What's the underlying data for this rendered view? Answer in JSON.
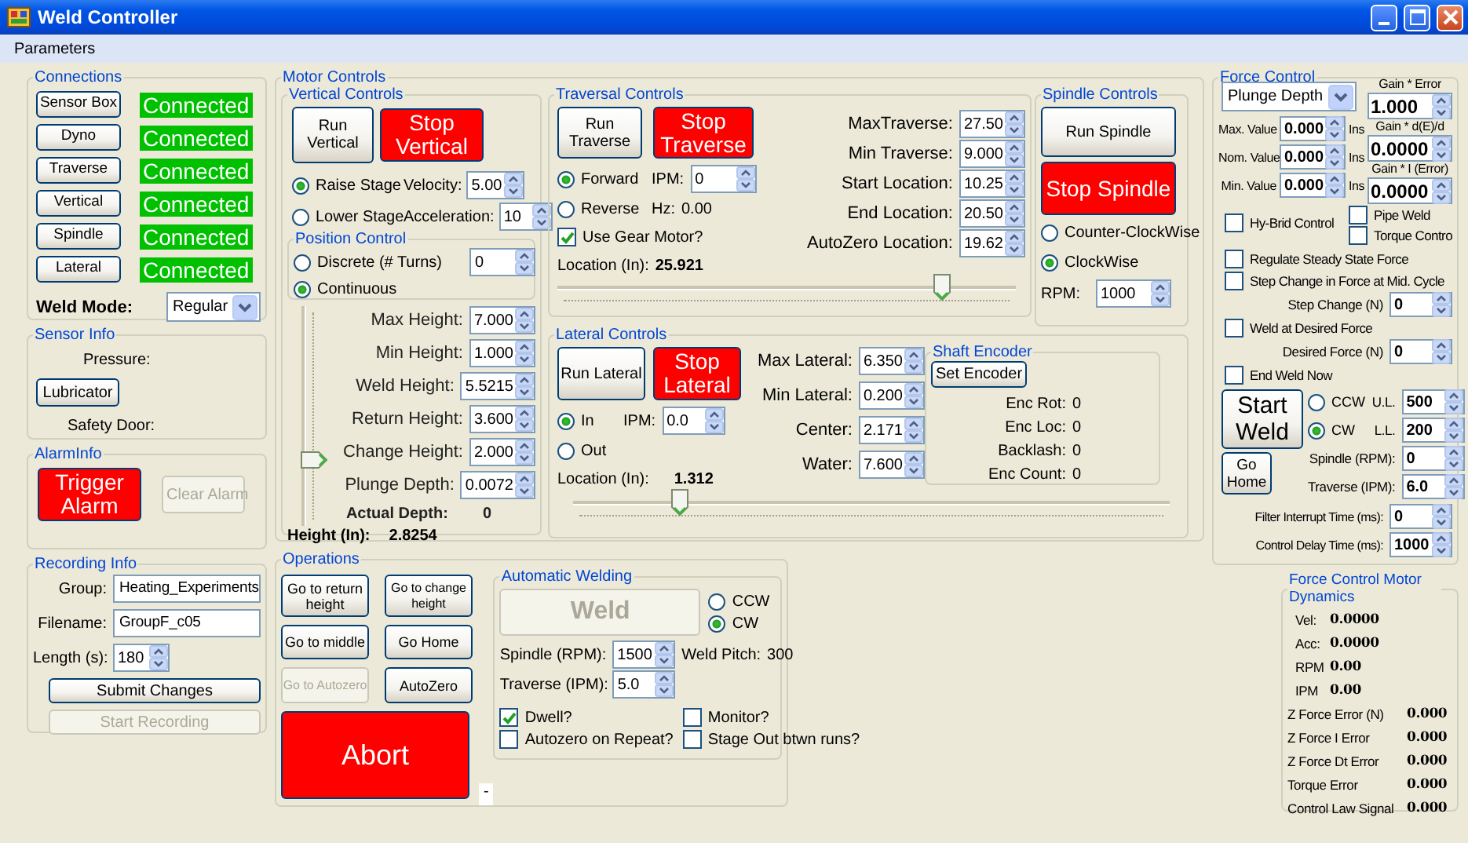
{
  "window": {
    "title": "Weld Controller"
  },
  "menu": [
    {
      "label": "Parameters"
    }
  ],
  "connections": {
    "title": "Connections",
    "rows": [
      [
        {
          "kind": "button",
          "label": "Sensor Box",
          "disabled": false
        },
        {
          "kind": "status",
          "text": "Connected"
        }
      ],
      [
        {
          "kind": "button",
          "label": "Dyno",
          "disabled": false
        },
        {
          "kind": "status",
          "text": "Connected"
        }
      ],
      [
        {
          "kind": "button",
          "label": "Traverse",
          "disabled": false
        },
        {
          "kind": "status",
          "text": "Connected"
        }
      ],
      [
        {
          "kind": "button",
          "label": "Vertical",
          "disabled": false
        },
        {
          "kind": "status",
          "text": "Connected"
        }
      ],
      [
        {
          "kind": "button",
          "label": "Spindle",
          "disabled": false
        },
        {
          "kind": "status",
          "text": "Connected"
        }
      ],
      [
        {
          "kind": "button",
          "label": "Lateral",
          "disabled": false
        },
        {
          "kind": "status",
          "text": "Connected"
        }
      ],
      [
        {
          "kind": "label_bold",
          "text": "Weld Mode:"
        },
        {
          "kind": "combo",
          "value": "Regular"
        }
      ]
    ]
  },
  "sensor_info": {
    "title": "Sensor Info",
    "rows": [
      [
        {
          "kind": "label",
          "text": "Pressure:"
        }
      ],
      [
        {
          "kind": "button",
          "label": "Lubricator",
          "disabled": false
        }
      ],
      [
        {
          "kind": "label",
          "text": "Safety Door:"
        }
      ]
    ]
  },
  "alarm_info": {
    "title": "AlarmInfo",
    "rows": [
      [
        {
          "kind": "stop_button",
          "label": "Trigger Alarm"
        },
        {
          "kind": "button",
          "label": "Clear Alarm",
          "disabled": true
        }
      ]
    ]
  },
  "recording_info": {
    "title": "Recording Info",
    "rows": [
      [
        {
          "kind": "label",
          "text": "Group:"
        },
        {
          "kind": "field",
          "value": "Heating_Experiments"
        }
      ],
      [
        {
          "kind": "label",
          "text": "Filename:"
        },
        {
          "kind": "field",
          "value": "GroupF_c05"
        }
      ],
      [
        {
          "kind": "label",
          "text": "Length (s):"
        },
        {
          "kind": "spin",
          "value": "180"
        }
      ],
      [
        {
          "kind": "button",
          "label": "Submit Changes",
          "disabled": false
        }
      ],
      [
        {
          "kind": "button",
          "label": "Start Recording",
          "disabled": true
        }
      ]
    ]
  },
  "motor_controls": {
    "title": "Motor Controls",
    "vertical": {
      "title": "Vertical Controls",
      "rows": [
        [
          {
            "kind": "button",
            "label": "Run Vertical",
            "disabled": false
          },
          {
            "kind": "stop_button",
            "label": "Stop Vertical"
          }
        ],
        [
          {
            "kind": "radio",
            "label": "Raise Stage",
            "selected": true
          },
          {
            "kind": "label",
            "text": "Velocity:"
          },
          {
            "kind": "spin",
            "value": "5.00"
          }
        ],
        [
          {
            "kind": "radio",
            "label": "Lower Stage",
            "selected": false
          },
          {
            "kind": "label",
            "text": "Acceleration:"
          },
          {
            "kind": "spin",
            "value": "10"
          }
        ]
      ],
      "position_control": {
        "title": "Position Control",
        "rows": [
          [
            {
              "kind": "radio",
              "label": "Discrete (# Turns)",
              "selected": false
            },
            {
              "kind": "spin",
              "value": "0"
            }
          ],
          [
            {
              "kind": "radio",
              "label": "Continuous",
              "selected": true
            }
          ]
        ]
      },
      "height_slider": {
        "level": 0.3
      },
      "heights": [
        [
          {
            "kind": "label",
            "text": "Max Height:"
          },
          {
            "kind": "spin",
            "value": "7.000"
          }
        ],
        [
          {
            "kind": "label",
            "text": "Min Height:"
          },
          {
            "kind": "spin",
            "value": "1.000"
          }
        ],
        [
          {
            "kind": "label",
            "text": "Weld Height:"
          },
          {
            "kind": "spin",
            "value": "5.5215"
          }
        ],
        [
          {
            "kind": "label",
            "text": "Return Height:"
          },
          {
            "kind": "spin",
            "value": "3.600"
          }
        ],
        [
          {
            "kind": "label",
            "text": "Change Height:"
          },
          {
            "kind": "spin",
            "value": "2.000"
          }
        ],
        [
          {
            "kind": "label",
            "text": "Plunge Depth:"
          },
          {
            "kind": "spin",
            "value": "0.0072"
          }
        ],
        [
          {
            "kind": "label_bold",
            "text": "Actual Depth:"
          },
          {
            "kind": "label_bold",
            "text": "0"
          }
        ]
      ],
      "readout": [
        {
          "kind": "label_bold",
          "text": "Height (In):"
        },
        {
          "kind": "label_bold",
          "text": "2.8254"
        }
      ]
    },
    "traversal": {
      "title": "Traversal Controls",
      "rows": [
        [
          {
            "kind": "button",
            "label": "Run Traverse",
            "disabled": false
          },
          {
            "kind": "stop_button",
            "label": "Stop Traverse"
          }
        ],
        [
          {
            "kind": "radio",
            "label": "Forward",
            "selected": true
          },
          {
            "kind": "label",
            "text": "IPM:"
          },
          {
            "kind": "spin",
            "value": "0"
          }
        ],
        [
          {
            "kind": "radio",
            "label": "Reverse",
            "selected": false
          },
          {
            "kind": "label",
            "text": "Hz:"
          },
          {
            "kind": "label",
            "text": "0.00"
          }
        ],
        [
          {
            "kind": "check",
            "label": "Use Gear Motor?",
            "checked": true
          }
        ],
        [
          {
            "kind": "label",
            "text": "Location (In):"
          },
          {
            "kind": "label_bold",
            "text": "25.921"
          }
        ]
      ],
      "limits": [
        [
          {
            "kind": "label",
            "text": "MaxTraverse:"
          },
          {
            "kind": "spin",
            "value": "27.50"
          }
        ],
        [
          {
            "kind": "label",
            "text": "Min Traverse:"
          },
          {
            "kind": "spin",
            "value": "9.000"
          }
        ],
        [
          {
            "kind": "label",
            "text": "Start Location:"
          },
          {
            "kind": "spin",
            "value": "10.25"
          }
        ],
        [
          {
            "kind": "label",
            "text": "End Location:"
          },
          {
            "kind": "spin",
            "value": "20.50"
          }
        ],
        [
          {
            "kind": "label",
            "text": "AutoZero Location:"
          },
          {
            "kind": "spin",
            "value": "19.62"
          }
        ]
      ],
      "slider": {
        "level": 0.84
      }
    },
    "spindle": {
      "title": "Spindle Controls",
      "rows": [
        [
          {
            "kind": "button",
            "label": "Run Spindle",
            "disabled": false
          }
        ],
        [
          {
            "kind": "stop_button",
            "label": "Stop Spindle"
          }
        ],
        [
          {
            "kind": "radio",
            "label": "Counter-ClockWise",
            "selected": false
          }
        ],
        [
          {
            "kind": "radio",
            "label": "ClockWise",
            "selected": true
          }
        ],
        [
          {
            "kind": "label",
            "text": "RPM:"
          },
          {
            "kind": "spin",
            "value": "1000"
          }
        ]
      ]
    },
    "lateral": {
      "title": "Lateral Controls",
      "rows": [
        [
          {
            "kind": "button",
            "label": "Run Lateral",
            "disabled": false
          },
          {
            "kind": "stop_button",
            "label": "Stop Lateral"
          }
        ],
        [
          {
            "kind": "radio",
            "label": "In",
            "selected": true
          },
          {
            "kind": "label",
            "text": "IPM:"
          },
          {
            "kind": "spin",
            "value": "0.0"
          }
        ],
        [
          {
            "kind": "radio",
            "label": "Out",
            "selected": false
          }
        ],
        [
          {
            "kind": "label",
            "text": "Location (In):"
          },
          {
            "kind": "label_bold",
            "text": "1.312"
          }
        ]
      ],
      "limits": [
        [
          {
            "kind": "label",
            "text": "Max Lateral:"
          },
          {
            "kind": "spin",
            "value": "6.350"
          }
        ],
        [
          {
            "kind": "label",
            "text": "Min Lateral:"
          },
          {
            "kind": "spin",
            "value": "0.200"
          }
        ],
        [
          {
            "kind": "label",
            "text": "Center:"
          },
          {
            "kind": "spin",
            "value": "2.171"
          }
        ],
        [
          {
            "kind": "label",
            "text": "Water:"
          },
          {
            "kind": "spin",
            "value": "7.600"
          }
        ]
      ],
      "shaft_encoder": {
        "title": "Shaft Encoder",
        "rows": [
          [
            {
              "kind": "button",
              "label": "Set Encoder",
              "disabled": false
            }
          ],
          [
            {
              "kind": "label",
              "text": "Enc Rot:"
            },
            {
              "kind": "label",
              "text": "0"
            }
          ],
          [
            {
              "kind": "label",
              "text": "Enc Loc:"
            },
            {
              "kind": "label",
              "text": "0"
            }
          ],
          [
            {
              "kind": "label",
              "text": "Backlash:"
            },
            {
              "kind": "label",
              "text": "0"
            }
          ],
          [
            {
              "kind": "label",
              "text": "Enc Count:"
            },
            {
              "kind": "label",
              "text": "0"
            }
          ]
        ]
      },
      "slider": {
        "level": 0.18
      }
    }
  },
  "operations": {
    "title": "Operations",
    "buttons": [
      [
        {
          "kind": "button",
          "label": "Go to return height",
          "disabled": false
        },
        {
          "kind": "button",
          "label": "Go to change height",
          "disabled": false
        }
      ],
      [
        {
          "kind": "button",
          "label": "Go to middle",
          "disabled": false
        },
        {
          "kind": "button",
          "label": "Go Home",
          "disabled": false
        }
      ],
      [
        {
          "kind": "button",
          "label": "Go to Autozero",
          "disabled": true
        },
        {
          "kind": "button",
          "label": "AutoZero",
          "disabled": false
        }
      ],
      [
        {
          "kind": "stop_button",
          "label": "Abort"
        }
      ]
    ],
    "note": "-",
    "automatic_welding": {
      "title": "Automatic Welding",
      "weld_button": {
        "kind": "button",
        "label": "Weld",
        "disabled": true
      },
      "direction": [
        {
          "kind": "radio",
          "label": "CCW",
          "selected": false
        },
        {
          "kind": "radio",
          "label": "CW",
          "selected": true
        }
      ],
      "rows": [
        [
          {
            "kind": "label",
            "text": "Spindle (RPM):"
          },
          {
            "kind": "spin",
            "value": "1500"
          },
          {
            "kind": "label",
            "text": "Weld Pitch:"
          },
          {
            "kind": "label",
            "text": "300"
          }
        ],
        [
          {
            "kind": "label",
            "text": "Traverse (IPM):"
          },
          {
            "kind": "spin",
            "value": "5.0"
          }
        ]
      ],
      "options": [
        [
          {
            "kind": "check",
            "label": "Dwell?",
            "checked": true
          },
          {
            "kind": "check",
            "label": "Monitor?",
            "checked": false
          }
        ],
        [
          {
            "kind": "check",
            "label": "Autozero on Repeat?",
            "checked": false
          },
          {
            "kind": "check",
            "label": "Stage Out btwn runs?",
            "checked": false
          }
        ]
      ]
    }
  },
  "force_control": {
    "title": "Force Control",
    "mode": {
      "kind": "combo",
      "value": "Plunge Depth"
    },
    "limits": [
      [
        {
          "kind": "label",
          "text": "Max. Value"
        },
        {
          "kind": "spin",
          "value": "0.000"
        },
        {
          "kind": "label",
          "text": "Ins"
        }
      ],
      [
        {
          "kind": "label",
          "text": "Nom. Value"
        },
        {
          "kind": "spin",
          "value": "0.000"
        },
        {
          "kind": "label",
          "text": "Ins"
        }
      ],
      [
        {
          "kind": "label",
          "text": "Min. Value"
        },
        {
          "kind": "spin",
          "value": "0.000"
        },
        {
          "kind": "label",
          "text": "Ins"
        }
      ]
    ],
    "gains": [
      [
        {
          "kind": "label",
          "text": "Gain * Error"
        }
      ],
      [
        {
          "kind": "spin",
          "value": "1.000"
        }
      ],
      [
        {
          "kind": "label",
          "text": "Gain * d(E)/d"
        }
      ],
      [
        {
          "kind": "spin",
          "value": "0.0000"
        }
      ],
      [
        {
          "kind": "label",
          "text": "Gain * I (Error)"
        }
      ],
      [
        {
          "kind": "spin",
          "value": "0.0000"
        }
      ]
    ],
    "side_left": [
      {
        "kind": "check",
        "label": "Hy-Brid Control",
        "checked": false
      }
    ],
    "side_right": [
      {
        "kind": "check",
        "label": "Pipe Weld",
        "checked": false
      },
      {
        "kind": "check",
        "label": "Torque Contro",
        "checked": false
      }
    ],
    "options": [
      [
        {
          "kind": "check",
          "label": "Regulate Steady State Force",
          "checked": false
        }
      ],
      [
        {
          "kind": "check",
          "label": "Step Change in Force at Mid. Cycle",
          "checked": false
        }
      ],
      [
        {
          "kind": "label",
          "text": "Step Change (N)"
        },
        {
          "kind": "spin",
          "value": "0"
        }
      ],
      [
        {
          "kind": "check",
          "label": "Weld at Desired Force",
          "checked": false
        }
      ],
      [
        {
          "kind": "label",
          "text": "Desired  Force (N)"
        },
        {
          "kind": "spin",
          "value": "0"
        }
      ],
      [
        {
          "kind": "check",
          "label": "End Weld Now",
          "checked": false
        }
      ]
    ],
    "weld_buttons": [
      {
        "kind": "button",
        "label": "Start Weld",
        "disabled": false
      },
      {
        "kind": "button",
        "label": "Go Home",
        "disabled": false
      }
    ],
    "weld_rows": [
      [
        {
          "kind": "radio",
          "label": "CCW",
          "selected": false
        },
        {
          "kind": "label",
          "text": "U.L."
        },
        {
          "kind": "spin",
          "value": "500"
        }
      ],
      [
        {
          "kind": "radio",
          "label": "CW",
          "selected": true
        },
        {
          "kind": "label",
          "text": "L.L."
        },
        {
          "kind": "spin",
          "value": "200"
        }
      ],
      [
        {
          "kind": "label",
          "text": "Spindle (RPM):"
        },
        {
          "kind": "spin",
          "value": "0"
        }
      ],
      [
        {
          "kind": "label",
          "text": "Traverse (IPM):"
        },
        {
          "kind": "spin",
          "value": "6.0"
        }
      ]
    ],
    "timing": [
      [
        {
          "kind": "label",
          "text": "Filter Interrupt Time (ms):"
        },
        {
          "kind": "spin",
          "value": "0"
        }
      ],
      [
        {
          "kind": "label",
          "text": "Control Delay Time (ms):"
        },
        {
          "kind": "spin",
          "value": "1000"
        }
      ]
    ]
  },
  "motor_dynamics": {
    "title": "Force Control Motor Dynamics",
    "rows": [
      [
        {
          "kind": "label",
          "text": "Vel:"
        },
        {
          "kind": "label_bold",
          "text": "0.0000"
        }
      ],
      [
        {
          "kind": "label",
          "text": "Acc:"
        },
        {
          "kind": "label_bold",
          "text": "0.0000"
        }
      ],
      [
        {
          "kind": "label",
          "text": "RPM"
        },
        {
          "kind": "label_bold",
          "text": "0.00"
        }
      ],
      [
        {
          "kind": "label",
          "text": "IPM"
        },
        {
          "kind": "label_bold",
          "text": "0.00"
        }
      ],
      [
        {
          "kind": "label",
          "text": "Z Force Error (N)"
        },
        {
          "kind": "label_bold",
          "text": "0.000"
        }
      ],
      [
        {
          "kind": "label",
          "text": "Z Force I Error"
        },
        {
          "kind": "label_bold",
          "text": "0.000"
        }
      ],
      [
        {
          "kind": "label",
          "text": "Z Force Dt Error"
        },
        {
          "kind": "label_bold",
          "text": "0.000"
        }
      ],
      [
        {
          "kind": "label",
          "text": "Torque Error"
        },
        {
          "kind": "label_bold",
          "text": "0.000"
        }
      ],
      [
        {
          "kind": "label",
          "text": "Control Law Signal"
        },
        {
          "kind": "label_bold",
          "text": "0.000"
        }
      ]
    ]
  }
}
